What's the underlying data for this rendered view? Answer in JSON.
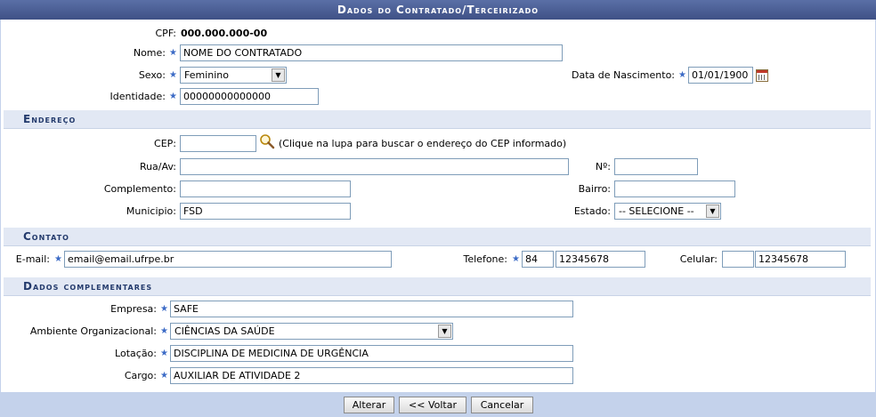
{
  "title": "Dados do Contratado/Terceirizado",
  "cpf": {
    "label": "CPF:",
    "value": "000.000.000-00"
  },
  "nome": {
    "label": "Nome:",
    "value": "NOME DO CONTRATADO"
  },
  "sexo": {
    "label": "Sexo:",
    "value": "Feminino"
  },
  "nascimento": {
    "label": "Data de Nascimento:",
    "value": "01/01/1900"
  },
  "identidade": {
    "label": "Identidade:",
    "value": "00000000000000"
  },
  "endereco": {
    "section": "Endereço",
    "cep_label": "CEP:",
    "cep_value": "",
    "cep_hint": "(Clique na lupa para buscar o endereço do CEP informado)",
    "rua_label": "Rua/Av:",
    "rua_value": "",
    "numero_label": "Nº:",
    "numero_value": "",
    "complemento_label": "Complemento:",
    "complemento_value": "",
    "bairro_label": "Bairro:",
    "bairro_value": "",
    "municipio_label": "Municipio:",
    "municipio_value": "FSD",
    "estado_label": "Estado:",
    "estado_value": "-- SELECIONE --"
  },
  "contato": {
    "section": "Contato",
    "email_label": "E-mail:",
    "email_value": "email@email.ufrpe.br",
    "telefone_label": "Telefone:",
    "telefone_ddd": "84",
    "telefone_numero": "12345678",
    "celular_label": "Celular:",
    "celular_ddd": "",
    "celular_numero": "12345678"
  },
  "complementares": {
    "section": "Dados complementares",
    "empresa_label": "Empresa:",
    "empresa_value": "SAFE",
    "ambiente_label": "Ambiente Organizacional:",
    "ambiente_value": "CIÊNCIAS DA SAÚDE",
    "lotacao_label": "Lotação:",
    "lotacao_value": "DISCIPLINA DE MEDICINA DE URGÊNCIA",
    "cargo_label": "Cargo:",
    "cargo_value": "AUXILIAR DE ATIVIDADE 2"
  },
  "buttons": {
    "alterar": "Alterar",
    "voltar": "<< Voltar",
    "cancelar": "Cancelar"
  },
  "icons": {
    "required": "star-icon",
    "calendar": "calendar-icon",
    "search": "magnifier-icon",
    "dropdown": "chevron-down-icon"
  },
  "colors": {
    "header": "#3f5186",
    "section_bg": "#e2e8f4",
    "required_star": "#3c6bc6"
  }
}
